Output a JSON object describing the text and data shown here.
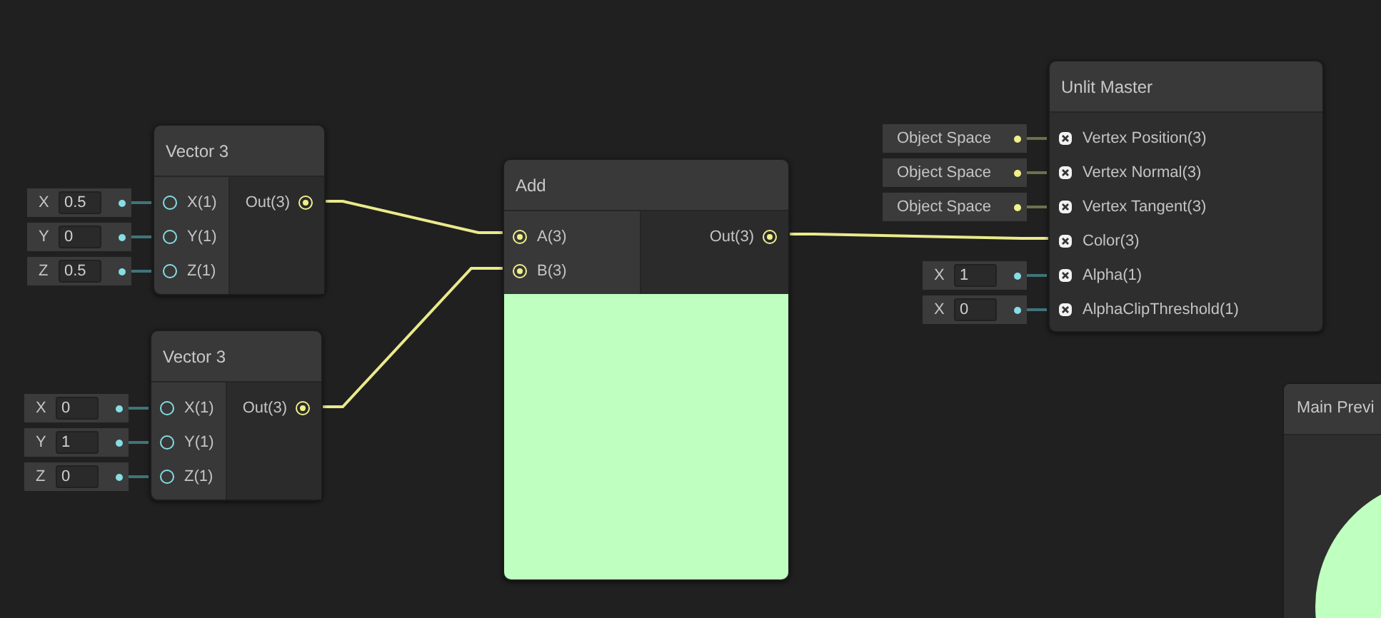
{
  "nodes": [
    {
      "kind": "vector3",
      "title": "Vector 3",
      "inputs": [
        {
          "label": "X(1)",
          "field": {
            "kind": "float",
            "label": "X",
            "value": "0.5"
          }
        },
        {
          "label": "Y(1)",
          "field": {
            "kind": "float",
            "label": "Y",
            "value": "0"
          }
        },
        {
          "label": "Z(1)",
          "field": {
            "kind": "float",
            "label": "Z",
            "value": "0.5"
          }
        }
      ],
      "outputs": [
        {
          "label": "Out(3)"
        }
      ]
    },
    {
      "kind": "vector3",
      "title": "Vector 3",
      "inputs": [
        {
          "label": "X(1)",
          "field": {
            "kind": "float",
            "label": "X",
            "value": "0"
          }
        },
        {
          "label": "Y(1)",
          "field": {
            "kind": "float",
            "label": "Y",
            "value": "1"
          }
        },
        {
          "label": "Z(1)",
          "field": {
            "kind": "float",
            "label": "Z",
            "value": "0"
          }
        }
      ],
      "outputs": [
        {
          "label": "Out(3)"
        }
      ]
    },
    {
      "kind": "add",
      "title": "Add",
      "inputs": [
        {
          "label": "A(3)"
        },
        {
          "label": "B(3)"
        }
      ],
      "outputs": [
        {
          "label": "Out(3)"
        }
      ]
    },
    {
      "kind": "master",
      "title": "Unlit Master",
      "inputs": [
        {
          "label": "Vertex Position(3)",
          "field": {
            "kind": "space",
            "value": "Object Space"
          }
        },
        {
          "label": "Vertex Normal(3)",
          "field": {
            "kind": "space",
            "value": "Object Space"
          }
        },
        {
          "label": "Vertex Tangent(3)",
          "field": {
            "kind": "space",
            "value": "Object Space"
          }
        },
        {
          "label": "Color(3)"
        },
        {
          "label": "Alpha(1)",
          "field": {
            "kind": "float",
            "label": "X",
            "value": "1"
          }
        },
        {
          "label": "AlphaClipThreshold(1)",
          "field": {
            "kind": "float",
            "label": "X",
            "value": "0"
          }
        }
      ]
    }
  ],
  "main_preview": {
    "title": "Main Previ"
  }
}
